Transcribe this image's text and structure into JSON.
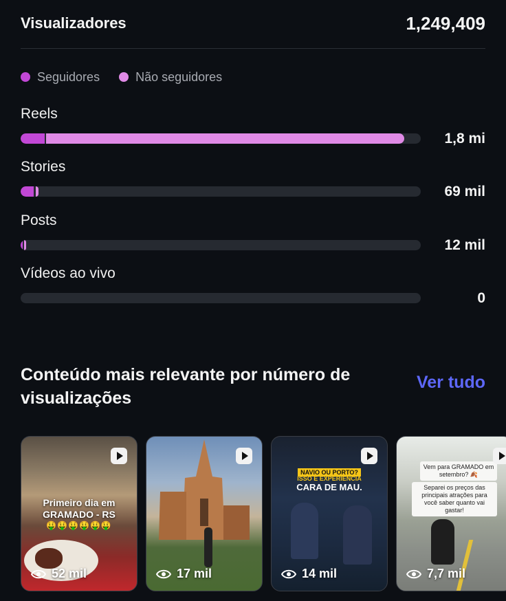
{
  "header": {
    "title": "Visualizadores",
    "total": "1,249,409"
  },
  "legend": [
    {
      "label": "Seguidores",
      "color": "#c248d6"
    },
    {
      "label": "Não seguidores",
      "color": "#e08ae6"
    }
  ],
  "metrics": [
    {
      "label": "Reels",
      "value": "1,8 mi",
      "followers_share": 0.06,
      "non_followers_share": 0.895
    },
    {
      "label": "Stories",
      "value": "69 mil",
      "followers_share": 0.033,
      "non_followers_share": 0.007
    },
    {
      "label": "Posts",
      "value": "12 mil",
      "followers_share": 0.005,
      "non_followers_share": 0.004
    },
    {
      "label": "Vídeos ao vivo",
      "value": "0",
      "followers_share": 0,
      "non_followers_share": 0
    }
  ],
  "section": {
    "heading": "Conteúdo mais relevante por número de visualizações",
    "link": "Ver tudo"
  },
  "thumbnails": [
    {
      "views": "52 mil",
      "icon": "reel-icon",
      "caption_line1": "Primeiro dia em",
      "caption_line2": "GRAMADO - RS",
      "emojis": "🤑🤑🤑🤑🤑🤑"
    },
    {
      "views": "17 mil",
      "icon": "reel-icon"
    },
    {
      "views": "14 mil",
      "icon": "reel-icon",
      "banner_top": "NAVIO OU PORTO?",
      "banner_mid": "ISSO É EXPERIÊNCIA",
      "banner_bottom": "CARA DE MAU."
    },
    {
      "views": "7,7 mil",
      "icon": "reel-icon",
      "note1": "Vem para GRAMADO em setembro? 🍂",
      "note2": "Separei os preços das principais atrações para você saber quanto vai gastar!"
    }
  ]
}
